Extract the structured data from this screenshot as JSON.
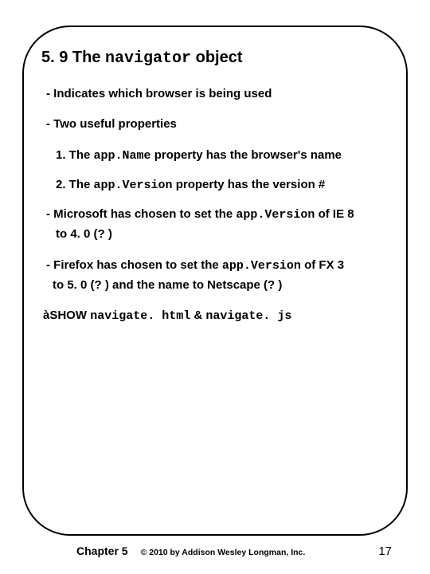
{
  "heading": {
    "pre": "5. 9 The ",
    "code": "navigator",
    "post": " object"
  },
  "bullets": {
    "b1": "- Indicates which browser is being used",
    "b2": "- Two useful properties",
    "s1_pre": "1. The ",
    "s1_code": "app.Name",
    "s1_post": " property has the browser's name",
    "s2_pre": "2. The ",
    "s2_code": "app.Version",
    "s2_post": " property has the version #",
    "b3_pre": "- Microsoft has chosen to set the ",
    "b3_code": "app.Version",
    "b3_post": " of IE 8",
    "b3_cont": "to 4. 0 (? )",
    "b4_pre": "- Firefox has chosen to set the ",
    "b4_code": "app.Version",
    "b4_post": " of FX 3",
    "b4_cont": "to 5. 0 (? ) and the name to Netscape (? )",
    "show_arrow": "à",
    "show_label": "SHOW ",
    "show_file1": "navigate. html",
    "show_amp": " & ",
    "show_file2": "navigate. js"
  },
  "footer": {
    "chapter": "Chapter 5",
    "copyright": "© 2010 by Addison Wesley Longman, Inc.",
    "page": "17"
  }
}
